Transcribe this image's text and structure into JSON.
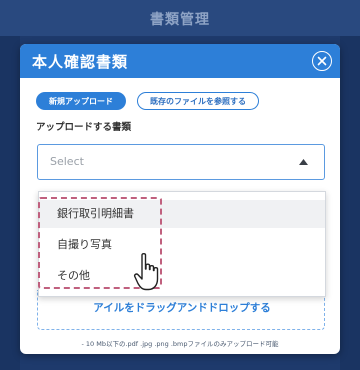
{
  "background_page": {
    "title": "書類管理"
  },
  "modal": {
    "title": "本人確認書類",
    "close_icon": "close-circle-icon",
    "tabs": [
      {
        "label": "新規アップロード",
        "active": true
      },
      {
        "label": "既存のファイルを参照する",
        "active": false
      }
    ],
    "field_label": "アップロードする書類",
    "select": {
      "placeholder": "Select",
      "caret_icon": "caret-up-icon",
      "options": [
        "銀行取引明細書",
        "自撮り写真",
        "その他"
      ],
      "hovered_index": 0
    },
    "drop_zone_text": "アイルをドラッグアンドドロップする",
    "note": "- 10 Mb以下の.pdf .jpg .png .bmpファイルのみアップロード可能"
  },
  "colors": {
    "primary": "#2d7fd8",
    "highlight_dash": "#c0607e",
    "backdrop": "#1e3a6c"
  },
  "cursor_icon": "hand-pointer-icon"
}
